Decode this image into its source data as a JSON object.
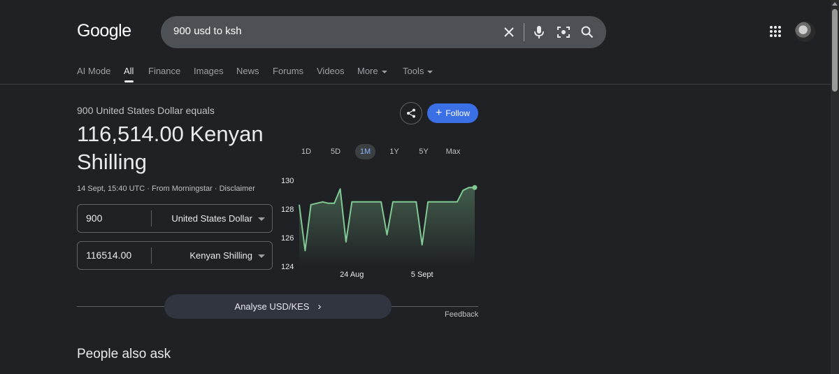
{
  "logo": "Google",
  "search": {
    "query": "900 usd to ksh"
  },
  "tabs": [
    {
      "label": "AI Mode"
    },
    {
      "label": "All"
    },
    {
      "label": "Finance"
    },
    {
      "label": "Images"
    },
    {
      "label": "News"
    },
    {
      "label": "Forums"
    },
    {
      "label": "Videos"
    },
    {
      "label": "More"
    },
    {
      "label": "Tools"
    }
  ],
  "converter": {
    "equals_text": "900 United States Dollar equals",
    "result_text": "116,514.00 Kenyan Shilling",
    "meta_text": "14 Sept, 15:40 UTC · From Morningstar · Disclaimer",
    "from_value": "900",
    "from_currency": "United States Dollar",
    "to_value": "116514.00",
    "to_currency": "Kenyan Shilling"
  },
  "actions": {
    "follow_label": "Follow"
  },
  "ranges": [
    {
      "label": "1D"
    },
    {
      "label": "5D"
    },
    {
      "label": "1M"
    },
    {
      "label": "1Y"
    },
    {
      "label": "5Y"
    },
    {
      "label": "Max"
    }
  ],
  "colors": {
    "line": "#81c995",
    "accent": "#3b6fe6",
    "active_range_text": "#8ab4f8"
  },
  "chart_data": {
    "type": "area",
    "ylim": [
      124,
      130
    ],
    "yticks": [
      "130",
      "128",
      "126",
      "124"
    ],
    "xtick_labels": [
      "24 Aug",
      "5 Sept"
    ],
    "x": [
      "15 Aug",
      "16 Aug",
      "17 Aug",
      "18 Aug",
      "19 Aug",
      "20 Aug",
      "21 Aug",
      "22 Aug",
      "23 Aug",
      "24 Aug",
      "25 Aug",
      "26 Aug",
      "27 Aug",
      "28 Aug",
      "29 Aug",
      "30 Aug",
      "31 Aug",
      "1 Sept",
      "2 Sept",
      "3 Sept",
      "4 Sept",
      "5 Sept",
      "6 Sept",
      "7 Sept",
      "8 Sept",
      "9 Sept",
      "10 Sept",
      "11 Sept",
      "12 Sept",
      "13 Sept",
      "14 Sept"
    ],
    "series": [
      {
        "values": [
          128.3,
          125.1,
          128.3,
          128.4,
          128.5,
          128.4,
          128.4,
          129.4,
          125.7,
          128.5,
          128.5,
          128.5,
          128.5,
          128.5,
          128.5,
          126.2,
          128.5,
          128.5,
          128.5,
          128.5,
          128.5,
          125.5,
          128.5,
          128.5,
          128.5,
          128.5,
          128.5,
          128.5,
          129.3,
          129.5,
          129.5
        ]
      }
    ],
    "grid": false,
    "legend": "none"
  },
  "analyse_label": "Analyse USD/KES",
  "feedback_label": "Feedback",
  "paa_title": "People also ask"
}
